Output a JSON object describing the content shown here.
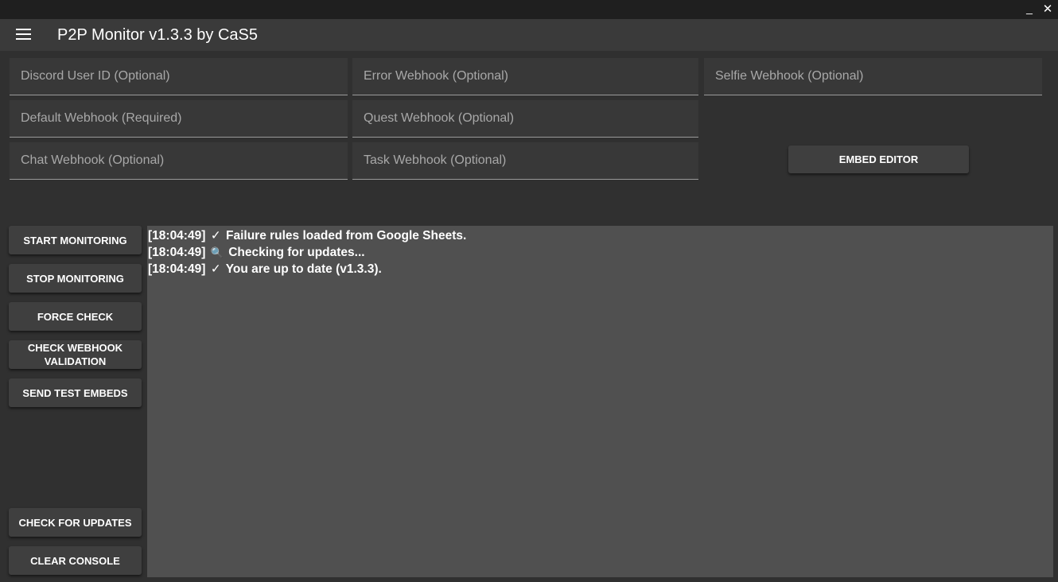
{
  "window": {
    "minimize_label": "_",
    "close_label": "✕"
  },
  "header": {
    "menu_icon": "hamburger-menu-icon",
    "title": "P2P Monitor v1.3.3 by CaS5"
  },
  "fields": {
    "discord_user_id": {
      "placeholder": "Discord User ID (Optional)",
      "value": ""
    },
    "error_webhook": {
      "placeholder": "Error Webhook (Optional)",
      "value": ""
    },
    "selfie_webhook": {
      "placeholder": "Selfie Webhook (Optional)",
      "value": ""
    },
    "default_webhook": {
      "placeholder": "Default Webhook (Required)",
      "value": ""
    },
    "quest_webhook": {
      "placeholder": "Quest Webhook (Optional)",
      "value": ""
    },
    "chat_webhook": {
      "placeholder": "Chat Webhook (Optional)",
      "value": ""
    },
    "task_webhook": {
      "placeholder": "Task Webhook (Optional)",
      "value": ""
    }
  },
  "buttons": {
    "embed_editor": "EMBED EDITOR",
    "start_monitoring": "START MONITORING",
    "stop_monitoring": "STOP MONITORING",
    "force_check": "FORCE CHECK",
    "check_webhook_validation": "CHECK WEBHOOK VALIDATION",
    "send_test_embeds": "SEND TEST EMBEDS",
    "check_for_updates": "CHECK FOR UPDATES",
    "clear_console": "CLEAR CONSOLE"
  },
  "console": {
    "lines": [
      {
        "timestamp": "[18:04:49]",
        "icon": "check-icon",
        "glyph": "✓",
        "text": "Failure rules loaded from Google Sheets."
      },
      {
        "timestamp": "[18:04:49]",
        "icon": "magnifier-icon",
        "glyph": "🔍",
        "text": "Checking for updates..."
      },
      {
        "timestamp": "[18:04:49]",
        "icon": "check-icon",
        "glyph": "✓",
        "text": "You are up to date (v1.3.3)."
      }
    ]
  },
  "colors": {
    "background": "#303030",
    "titlebar": "#1f1f1f",
    "appbar": "#3a3a3a",
    "field": "#383838",
    "button": "#3f3f3f",
    "console": "#505050",
    "text": "#ffffff"
  }
}
